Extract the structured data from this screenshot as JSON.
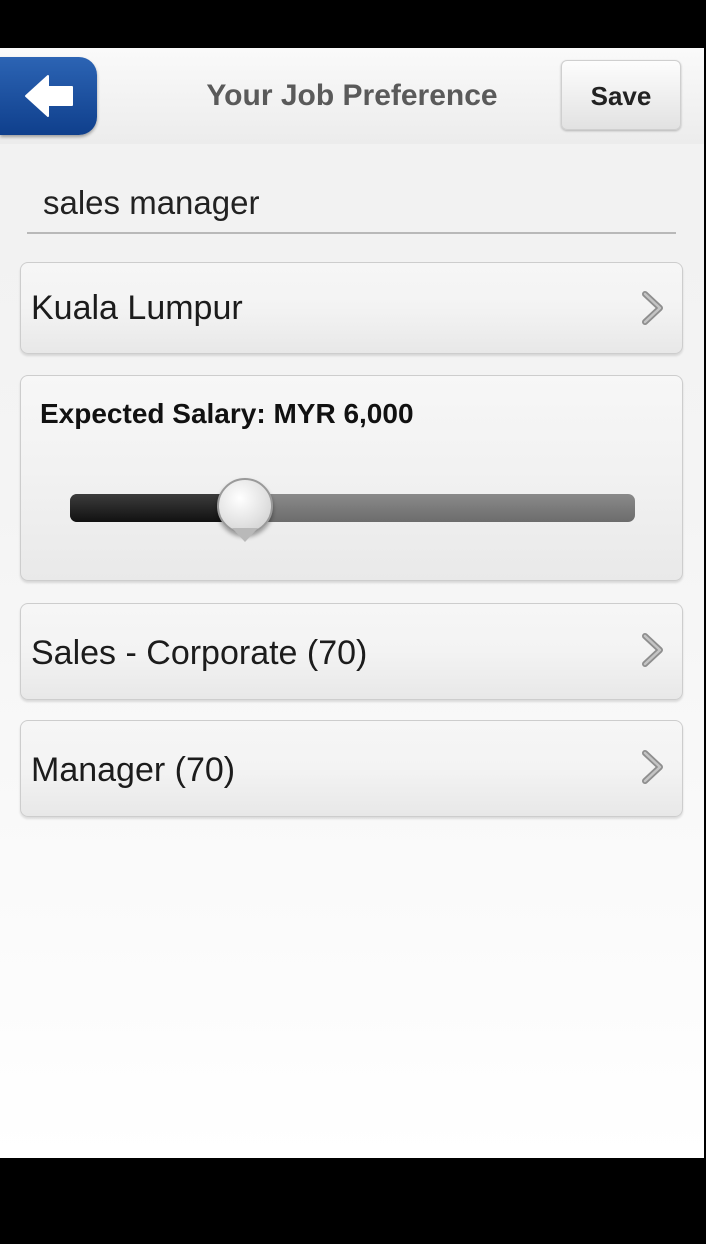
{
  "header": {
    "title": "Your Job Preference",
    "save_label": "Save",
    "back_icon": "back-arrow-icon",
    "accent_color": "#1a4f9e"
  },
  "keyword": {
    "value": "sales manager"
  },
  "location": {
    "label": "Kuala Lumpur",
    "icon": "chevron-right-icon"
  },
  "salary": {
    "label": "Expected Salary: MYR 6,000",
    "currency": "MYR",
    "value": 6000,
    "slider_fraction": 0.31
  },
  "specialization": {
    "label": "Sales - Corporate (70)",
    "icon": "chevron-right-icon"
  },
  "position_level": {
    "label": "Manager (70)",
    "icon": "chevron-right-icon"
  }
}
